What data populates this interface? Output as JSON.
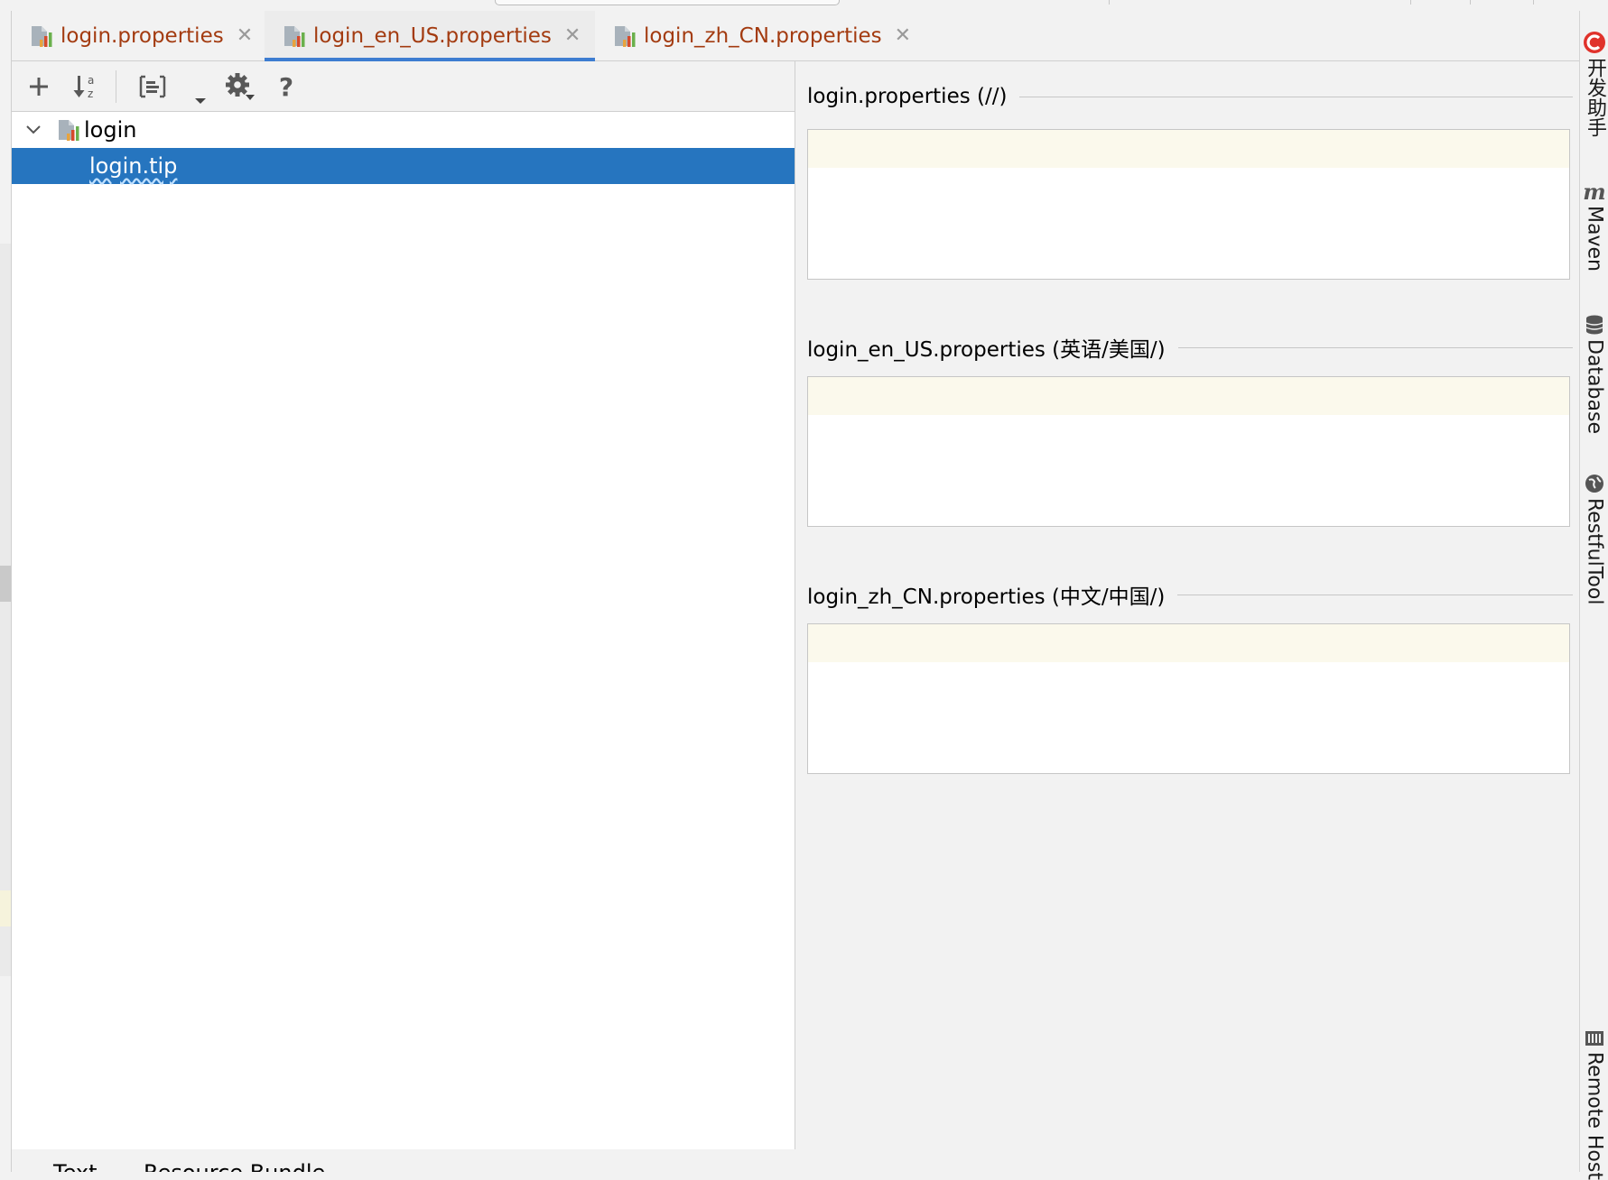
{
  "tabs": [
    {
      "label": "login.properties",
      "close": "✕",
      "active": false
    },
    {
      "label": "login_en_US.properties",
      "close": "✕",
      "active": true
    },
    {
      "label": "login_zh_CN.properties",
      "close": "✕",
      "active": false
    }
  ],
  "toolbar": {
    "add": "+",
    "help": "?"
  },
  "tree": {
    "root": {
      "label": "login",
      "expanded": true
    },
    "selected_key": "login.tip"
  },
  "editor": {
    "groups": [
      {
        "title": "login.properties (//)",
        "value": ""
      },
      {
        "title": "login_en_US.properties (英语/美国/)",
        "value": ""
      },
      {
        "title": "login_zh_CN.properties (中文/中国/)",
        "value": ""
      }
    ]
  },
  "tool_windows": {
    "kaifa": "开发助手",
    "maven": "Maven",
    "database": "Database",
    "restful": "RestfulTool",
    "remote": "Remote Host"
  },
  "bottom_tabs": [
    "Text",
    "Resource Bundle"
  ],
  "colors": {
    "tab_text": "#a33b10",
    "selection": "#2675bf",
    "active_tab_underline": "#3d7dd1",
    "current_line": "#fbf9ec"
  },
  "icons": {
    "file": "resource-bundle-icon",
    "add": "add-icon",
    "sort": "sort-alpha-icon",
    "group": "group-by-prefix-icon",
    "settings": "gear-icon",
    "help": "help-icon"
  }
}
